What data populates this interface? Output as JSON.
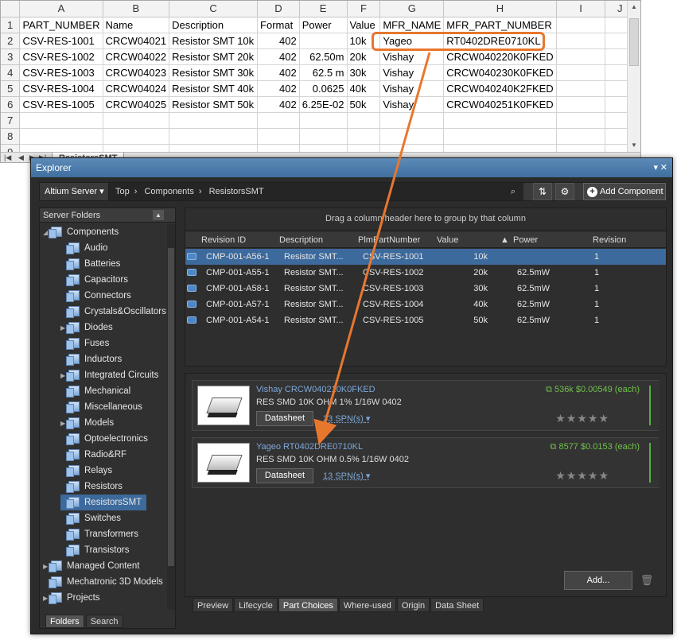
{
  "sheet": {
    "col_headers": [
      "A",
      "B",
      "C",
      "D",
      "E",
      "F",
      "G",
      "H",
      "I",
      "J"
    ],
    "row_numbers": [
      "1",
      "2",
      "3",
      "4",
      "5",
      "6",
      "7",
      "8",
      "9"
    ],
    "header_row": [
      "PART_NUMBER",
      "Name",
      "Description",
      "Format",
      "Power",
      "Value",
      "MFR_NAME",
      "MFR_PART_NUMBER",
      "",
      ""
    ],
    "rows": [
      [
        "CSV-RES-1001",
        "CRCW04021",
        "Resistor SMT 10k",
        "402",
        "",
        "10k",
        "Yageo",
        "RT0402DRE0710KL",
        "",
        ""
      ],
      [
        "CSV-RES-1002",
        "CRCW04022",
        "Resistor SMT 20k",
        "402",
        "62.50m",
        "20k",
        "Vishay",
        "CRCW040220K0FKED",
        "",
        ""
      ],
      [
        "CSV-RES-1003",
        "CRCW04023",
        "Resistor SMT 30k",
        "402",
        "62.5 m",
        "30k",
        "Vishay",
        "CRCW040230K0FKED",
        "",
        ""
      ],
      [
        "CSV-RES-1004",
        "CRCW04024",
        "Resistor SMT 40k",
        "402",
        "0.0625",
        "40k",
        "Vishay",
        "CRCW040240K2FKED",
        "",
        ""
      ],
      [
        "CSV-RES-1005",
        "CRCW04025",
        "Resistor SMT 50k",
        "402",
        "6.25E-02",
        "50k",
        "Vishay",
        "CRCW040251K0FKED",
        "",
        ""
      ]
    ],
    "sheet_tab": "ResistorsSMT"
  },
  "explorer": {
    "title": "Explorer",
    "server": "Altium Server",
    "breadcrumb": [
      "Top",
      "Components",
      "ResistorsSMT"
    ],
    "add_component": "Add Component",
    "folders_header": "Server Folders",
    "folders": [
      {
        "label": "Components",
        "indent": 0,
        "tw": "◢"
      },
      {
        "label": "Audio",
        "indent": 1,
        "tw": ""
      },
      {
        "label": "Batteries",
        "indent": 1,
        "tw": ""
      },
      {
        "label": "Capacitors",
        "indent": 1,
        "tw": ""
      },
      {
        "label": "Connectors",
        "indent": 1,
        "tw": ""
      },
      {
        "label": "Crystals&Oscillators",
        "indent": 1,
        "tw": ""
      },
      {
        "label": "Diodes",
        "indent": 1,
        "tw": "▶"
      },
      {
        "label": "Fuses",
        "indent": 1,
        "tw": ""
      },
      {
        "label": "Inductors",
        "indent": 1,
        "tw": ""
      },
      {
        "label": "Integrated Circuits",
        "indent": 1,
        "tw": "▶"
      },
      {
        "label": "Mechanical",
        "indent": 1,
        "tw": ""
      },
      {
        "label": "Miscellaneous",
        "indent": 1,
        "tw": ""
      },
      {
        "label": "Models",
        "indent": 1,
        "tw": "▶"
      },
      {
        "label": "Optoelectronics",
        "indent": 1,
        "tw": ""
      },
      {
        "label": "Radio&RF",
        "indent": 1,
        "tw": ""
      },
      {
        "label": "Relays",
        "indent": 1,
        "tw": ""
      },
      {
        "label": "Resistors",
        "indent": 1,
        "tw": ""
      },
      {
        "label": "ResistorsSMT",
        "indent": 1,
        "tw": "",
        "selected": true
      },
      {
        "label": "Switches",
        "indent": 1,
        "tw": ""
      },
      {
        "label": "Transformers",
        "indent": 1,
        "tw": ""
      },
      {
        "label": "Transistors",
        "indent": 1,
        "tw": ""
      },
      {
        "label": "Managed Content",
        "indent": 0,
        "tw": "▶"
      },
      {
        "label": "Mechatronic 3D Models",
        "indent": 0,
        "tw": ""
      },
      {
        "label": "Projects",
        "indent": 0,
        "tw": "▶"
      }
    ],
    "folder_tabs": [
      "Folders",
      "Search"
    ],
    "group_hint": "Drag a column header here to group by that column",
    "grid_columns": [
      "Revision ID",
      "Description",
      "PlmPartNumber",
      "Value",
      "Power",
      "Revision"
    ],
    "grid_rows": [
      [
        "CMP-001-A56-1",
        "Resistor SMT...",
        "CSV-RES-1001",
        "10k",
        "",
        "1"
      ],
      [
        "CMP-001-A55-1",
        "Resistor SMT...",
        "CSV-RES-1002",
        "20k",
        "62.5mW",
        "1"
      ],
      [
        "CMP-001-A58-1",
        "Resistor SMT...",
        "CSV-RES-1003",
        "30k",
        "62.5mW",
        "1"
      ],
      [
        "CMP-001-A57-1",
        "Resistor SMT...",
        "CSV-RES-1004",
        "40k",
        "62.5mW",
        "1"
      ],
      [
        "CMP-001-A54-1",
        "Resistor SMT...",
        "CSV-RES-1005",
        "50k",
        "62.5mW",
        "1"
      ]
    ],
    "part_choices": [
      {
        "mfr": "Vishay CRCW040210K0FKED",
        "desc": "RES SMD 10K OHM 1% 1/16W 0402",
        "datasheet": "Datasheet",
        "spn": "33 SPN(s)",
        "stock": "536k",
        "price": "$0.00549 (each)",
        "stars": "★★★★★"
      },
      {
        "mfr": "Yageo RT0402DRE0710KL",
        "desc": "RES SMD 10K OHM 0.5% 1/16W 0402",
        "datasheet": "Datasheet",
        "spn": "13 SPN(s)",
        "stock": "8577",
        "price": "$0.0153 (each)",
        "stars": "★★★★★"
      }
    ],
    "add_button": "Add...",
    "bottom_tabs": [
      "Preview",
      "Lifecycle",
      "Part Choices",
      "Where-used",
      "Origin",
      "Data Sheet"
    ]
  },
  "colors": {
    "highlight": "#e8772e",
    "selection": "#3d6a9c",
    "link": "#7ea7d8",
    "stock": "#6fc04a"
  }
}
